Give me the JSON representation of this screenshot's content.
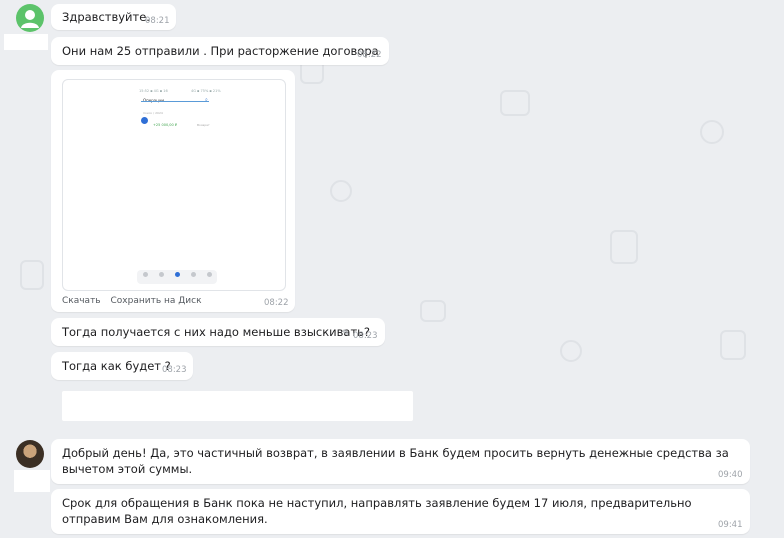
{
  "messages": [
    {
      "text": "Здравствуйте.",
      "time": "08:21"
    },
    {
      "text": "Они нам 25 отправили . При расторжение договора",
      "time": "08:22"
    },
    {
      "type": "image",
      "time": "08:22",
      "image": {
        "status_left": "15:52 ▪ 4G ▪ 16",
        "status_right": "4G ▪ 75% ▪ 21%",
        "title": "Операции",
        "search": "поиск / 2024",
        "amount": "+25 000,00 ₽",
        "sub": "Возврат"
      },
      "actions": {
        "download": "Скачать",
        "save": "Сохранить на Диск"
      }
    },
    {
      "text": "Тогда получается с них надо меньше взыскивать?",
      "time": "08:23",
      "edited": true,
      "edit_icon": "pencil-icon"
    },
    {
      "text": "Тогда как будет ?",
      "time": "08:23"
    },
    {
      "text": "Добрый день! Да, это частичный возврат, в заявлении в Банк будем просить вернуть денежные средства за вычетом этой суммы.",
      "time": "09:40"
    },
    {
      "text": "Срок для обращения в Банк пока не наступил, направлять заявление будем 17 июля, предварительно отправим Вам для ознакомления.",
      "time": "09:41"
    }
  ],
  "colors": {
    "background": "#eceef1",
    "bubble": "#ffffff",
    "time": "#9ea3a9",
    "avatar_green": "#5cc36a"
  }
}
